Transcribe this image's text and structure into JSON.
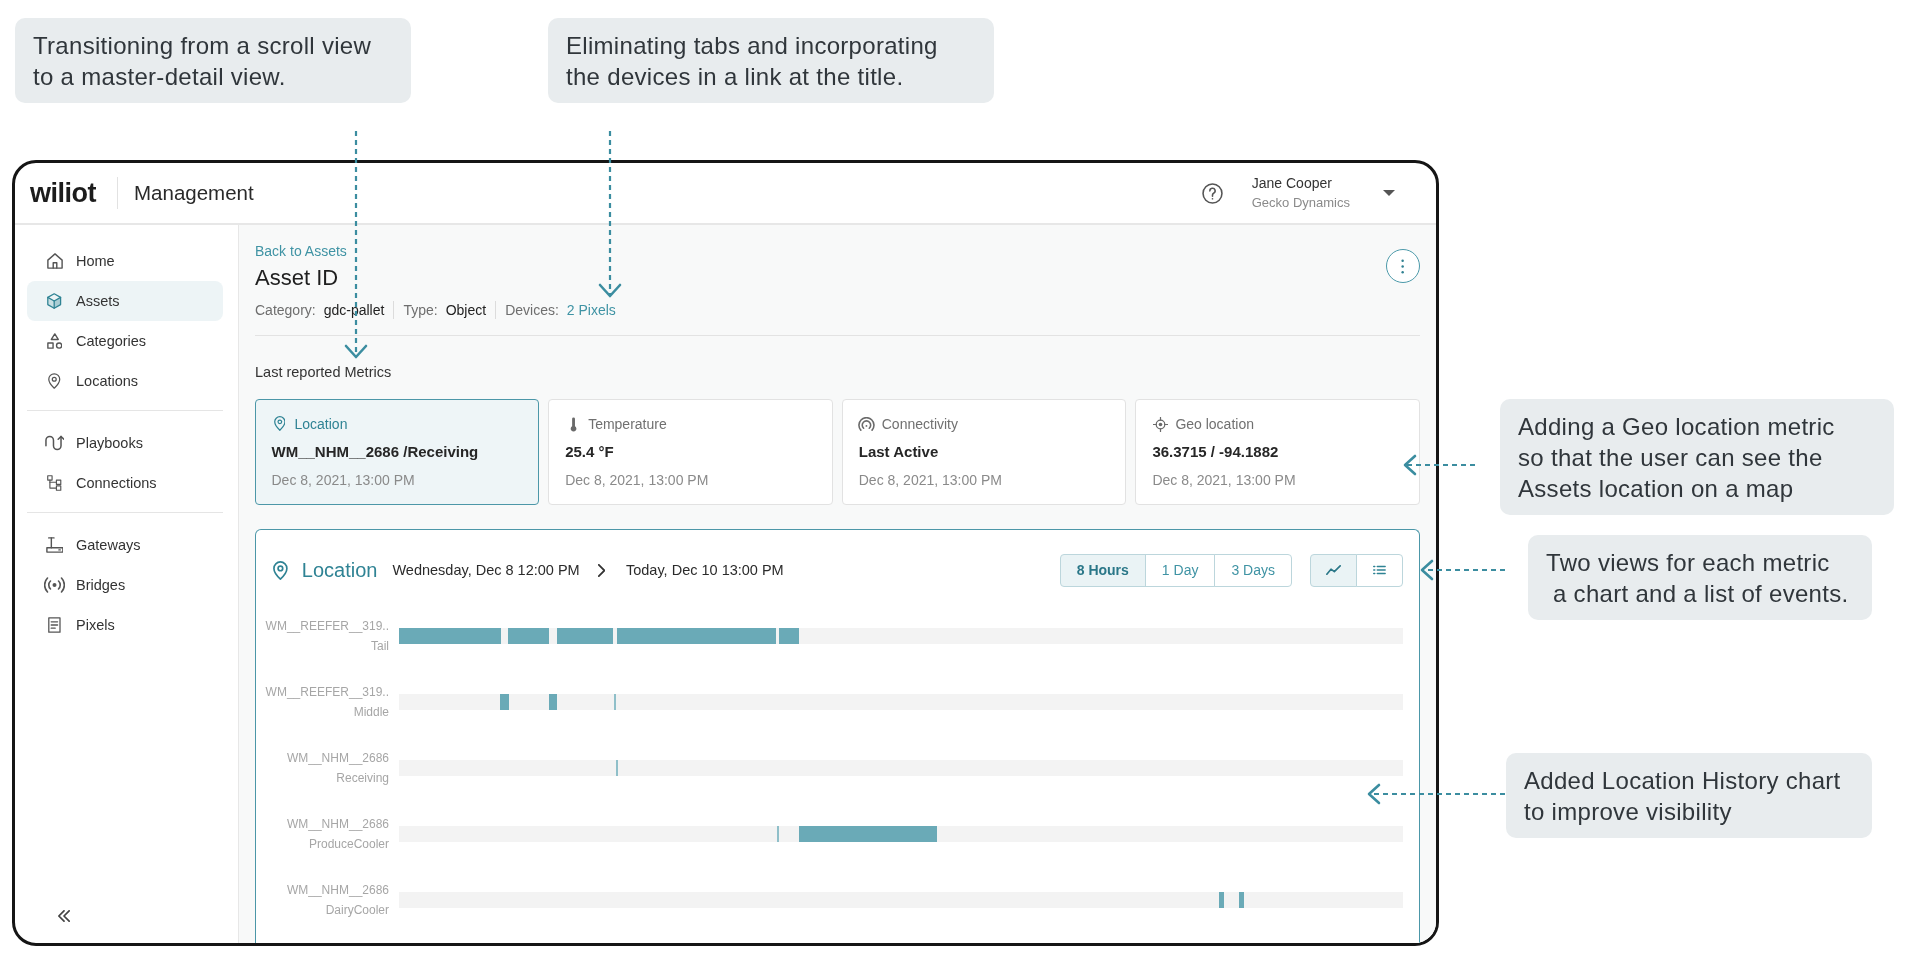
{
  "callouts": [
    {
      "text": "Transitioning from a scroll view\nto a master-detail view."
    },
    {
      "text": "Eliminating tabs and incorporating\nthe devices in a link at the title."
    },
    {
      "text": "Adding a Geo location metric\nso that the user can see the\nAssets location on a map"
    },
    {
      "text": "Two views for each metric\n a chart and a list of events."
    },
    {
      "text": "Added Location History chart\nto improve visibility"
    }
  ],
  "app": {
    "logo": "wiliot",
    "title": "Management",
    "user": {
      "name": "Jane Cooper",
      "company": "Gecko Dynamics"
    }
  },
  "sidebar": {
    "sections": [
      {
        "items": [
          {
            "label": "Home",
            "selected": false
          },
          {
            "label": "Assets",
            "selected": true
          },
          {
            "label": "Categories",
            "selected": false
          },
          {
            "label": "Locations",
            "selected": false
          }
        ]
      },
      {
        "items": [
          {
            "label": "Playbooks",
            "selected": false
          },
          {
            "label": "Connections",
            "selected": false
          }
        ]
      },
      {
        "items": [
          {
            "label": "Gateways",
            "selected": false
          },
          {
            "label": "Bridges",
            "selected": false
          },
          {
            "label": "Pixels",
            "selected": false
          }
        ]
      }
    ]
  },
  "page": {
    "back_link": "Back to Assets",
    "title": "Asset ID",
    "properties": [
      {
        "label": "Category:",
        "value": "gdc-pallet",
        "kind": "text"
      },
      {
        "label": "Type:",
        "value": "Object",
        "kind": "text"
      },
      {
        "label": "Devices:",
        "value": "2 Pixels",
        "kind": "link"
      }
    ]
  },
  "metrics": {
    "title": "Last reported Metrics",
    "cards": [
      {
        "label": "Location",
        "value": "WM__NHM__2686 /Receiving",
        "time": "Dec 8, 2021, 13:00 PM",
        "selected": true
      },
      {
        "label": "Temperature",
        "value": "25.4 °F",
        "time": "Dec 8, 2021, 13:00 PM",
        "selected": false
      },
      {
        "label": "Connectivity",
        "value": "Last Active",
        "time": "Dec 8, 2021, 13:00 PM",
        "selected": false
      },
      {
        "label": "Geo location",
        "value": "36.3715 / -94.1882",
        "time": "Dec 8, 2021, 13:00 PM",
        "selected": false
      }
    ]
  },
  "location_panel": {
    "title": "Location",
    "from": "Wednesday, Dec 8 12:00 PM",
    "to": "Today, Dec 10 13:00 PM",
    "ranges": [
      {
        "label": "8 Hours",
        "selected": true
      },
      {
        "label": "1 Day",
        "selected": false
      },
      {
        "label": "3 Days",
        "selected": false
      }
    ],
    "views": [
      {
        "kind": "chart",
        "selected": true
      },
      {
        "kind": "list",
        "selected": false
      }
    ],
    "rows": [
      {
        "device": "WM__REEFER__319..",
        "zone": "Tail"
      },
      {
        "device": "WM__REEFER__319..",
        "zone": "Middle"
      },
      {
        "device": "WM__NHM__2686",
        "zone": "Receiving"
      },
      {
        "device": "WM__NHM__2686",
        "zone": "ProduceCooler"
      },
      {
        "device": "WM__NHM__2686",
        "zone": "DairyCooler"
      }
    ]
  }
}
